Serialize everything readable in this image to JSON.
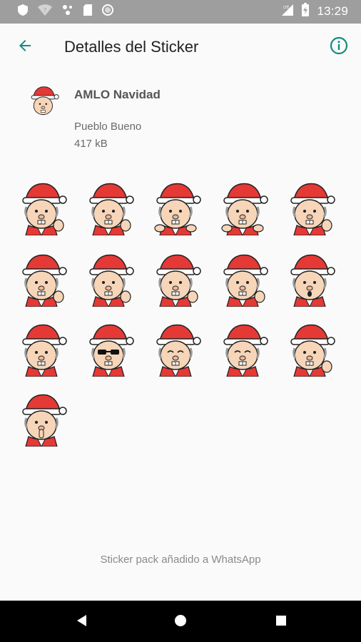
{
  "status_bar": {
    "time": "13:29",
    "icons": [
      "shield-icon",
      "wifi-icon",
      "assistant-icon",
      "sd-card-icon",
      "circle-icon",
      "signal-icon",
      "battery-icon"
    ]
  },
  "app_bar": {
    "title": "Detalles del Sticker",
    "back_icon": "arrow-back-icon",
    "info_icon": "info-outline-icon",
    "accent_color": "#128C7E"
  },
  "pack": {
    "name": "AMLO Navidad",
    "publisher": "Pueblo Bueno",
    "size": "417 kB"
  },
  "stickers": [
    {
      "variant": "thumbs-up"
    },
    {
      "variant": "thumbs-down"
    },
    {
      "variant": "hands-together"
    },
    {
      "variant": "open-arms"
    },
    {
      "variant": "peace-sign"
    },
    {
      "variant": "wave"
    },
    {
      "variant": "peace-sign"
    },
    {
      "variant": "peace-sign"
    },
    {
      "variant": "pointing"
    },
    {
      "variant": "surprised"
    },
    {
      "variant": "smile"
    },
    {
      "variant": "sunglasses"
    },
    {
      "variant": "laughing"
    },
    {
      "variant": "blank-stare"
    },
    {
      "variant": "ok-sign"
    },
    {
      "variant": "shush"
    }
  ],
  "footer": {
    "message": "Sticker pack añadido a WhatsApp"
  },
  "nav_bar": {
    "buttons": [
      "back-triangle-icon",
      "home-circle-icon",
      "recents-square-icon"
    ]
  }
}
